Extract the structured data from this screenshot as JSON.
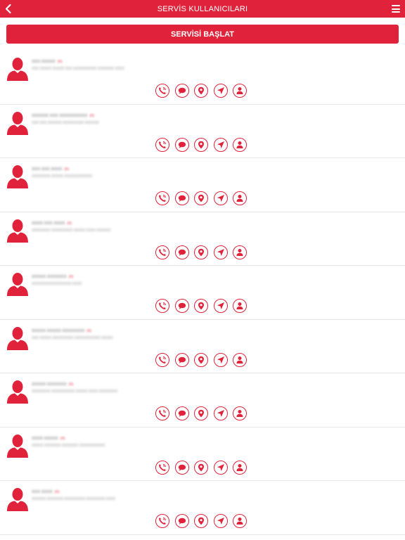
{
  "header": {
    "title": "SERVİS KULLANICILARI"
  },
  "start_button": {
    "label": "SERVİSİ BAŞLAT"
  },
  "colors": {
    "brand": "#e0233a",
    "divider": "#e6e6e6"
  },
  "icons": {
    "back": "chevron-left-icon",
    "menu": "hamburger-menu-icon",
    "avatar": "user-silhouette-icon",
    "actions": [
      "phone-call-icon",
      "chat-bubble-icon",
      "map-pin-icon",
      "navigation-arrow-icon",
      "user-profile-icon"
    ]
  },
  "users": [
    {
      "name": "XXX XXXXX",
      "tag": "(X)",
      "detail": "XXX XXXXX XXXXX XXX XXXXXXXXXX XXXXXXX XXXX"
    },
    {
      "name": "XXXXXX XXX XXXXXXXXXX",
      "tag": "(X)",
      "detail": "XXX XXX XXXXXX XXXXXXXXX XXXXXX"
    },
    {
      "name": "XXX XXX XXXX",
      "tag": "(X)",
      "detail": "XXXXXXXX XXXXX XXXXXXXXXXXX"
    },
    {
      "name": "XXXX XXX XXXX",
      "tag": "(X)",
      "detail": "XXXXXXXX XXXXXXXXX XXXXX XXXX XXXXXX"
    },
    {
      "name": "XXXXX XXXXXXX",
      "tag": "(X)",
      "detail": "XXXXXXXXXXXXXXXXX XXXX"
    },
    {
      "name": "XXXXX XXXXX XXXXXXXX",
      "tag": "(X)",
      "detail": "XXX XXXXX XXXXXXXXX XXXXXXXXXXX XXXXX"
    },
    {
      "name": "XXXXX XXXXXXX",
      "tag": "(X)",
      "detail": "XXXXXXXX XXXXXXXXXX XXXXX XXXX XXXXXXXX"
    },
    {
      "name": "XXXX XXXXX",
      "tag": "(X)",
      "detail": "XXXXX XXXXXXX XXXXXXX XXXXXXXXXXX"
    },
    {
      "name": "XXX XXXX",
      "tag": "(X)",
      "detail": "XXXXXX XXXXXXX XXXXXXXXX XXXXXXXX XXXX"
    }
  ]
}
